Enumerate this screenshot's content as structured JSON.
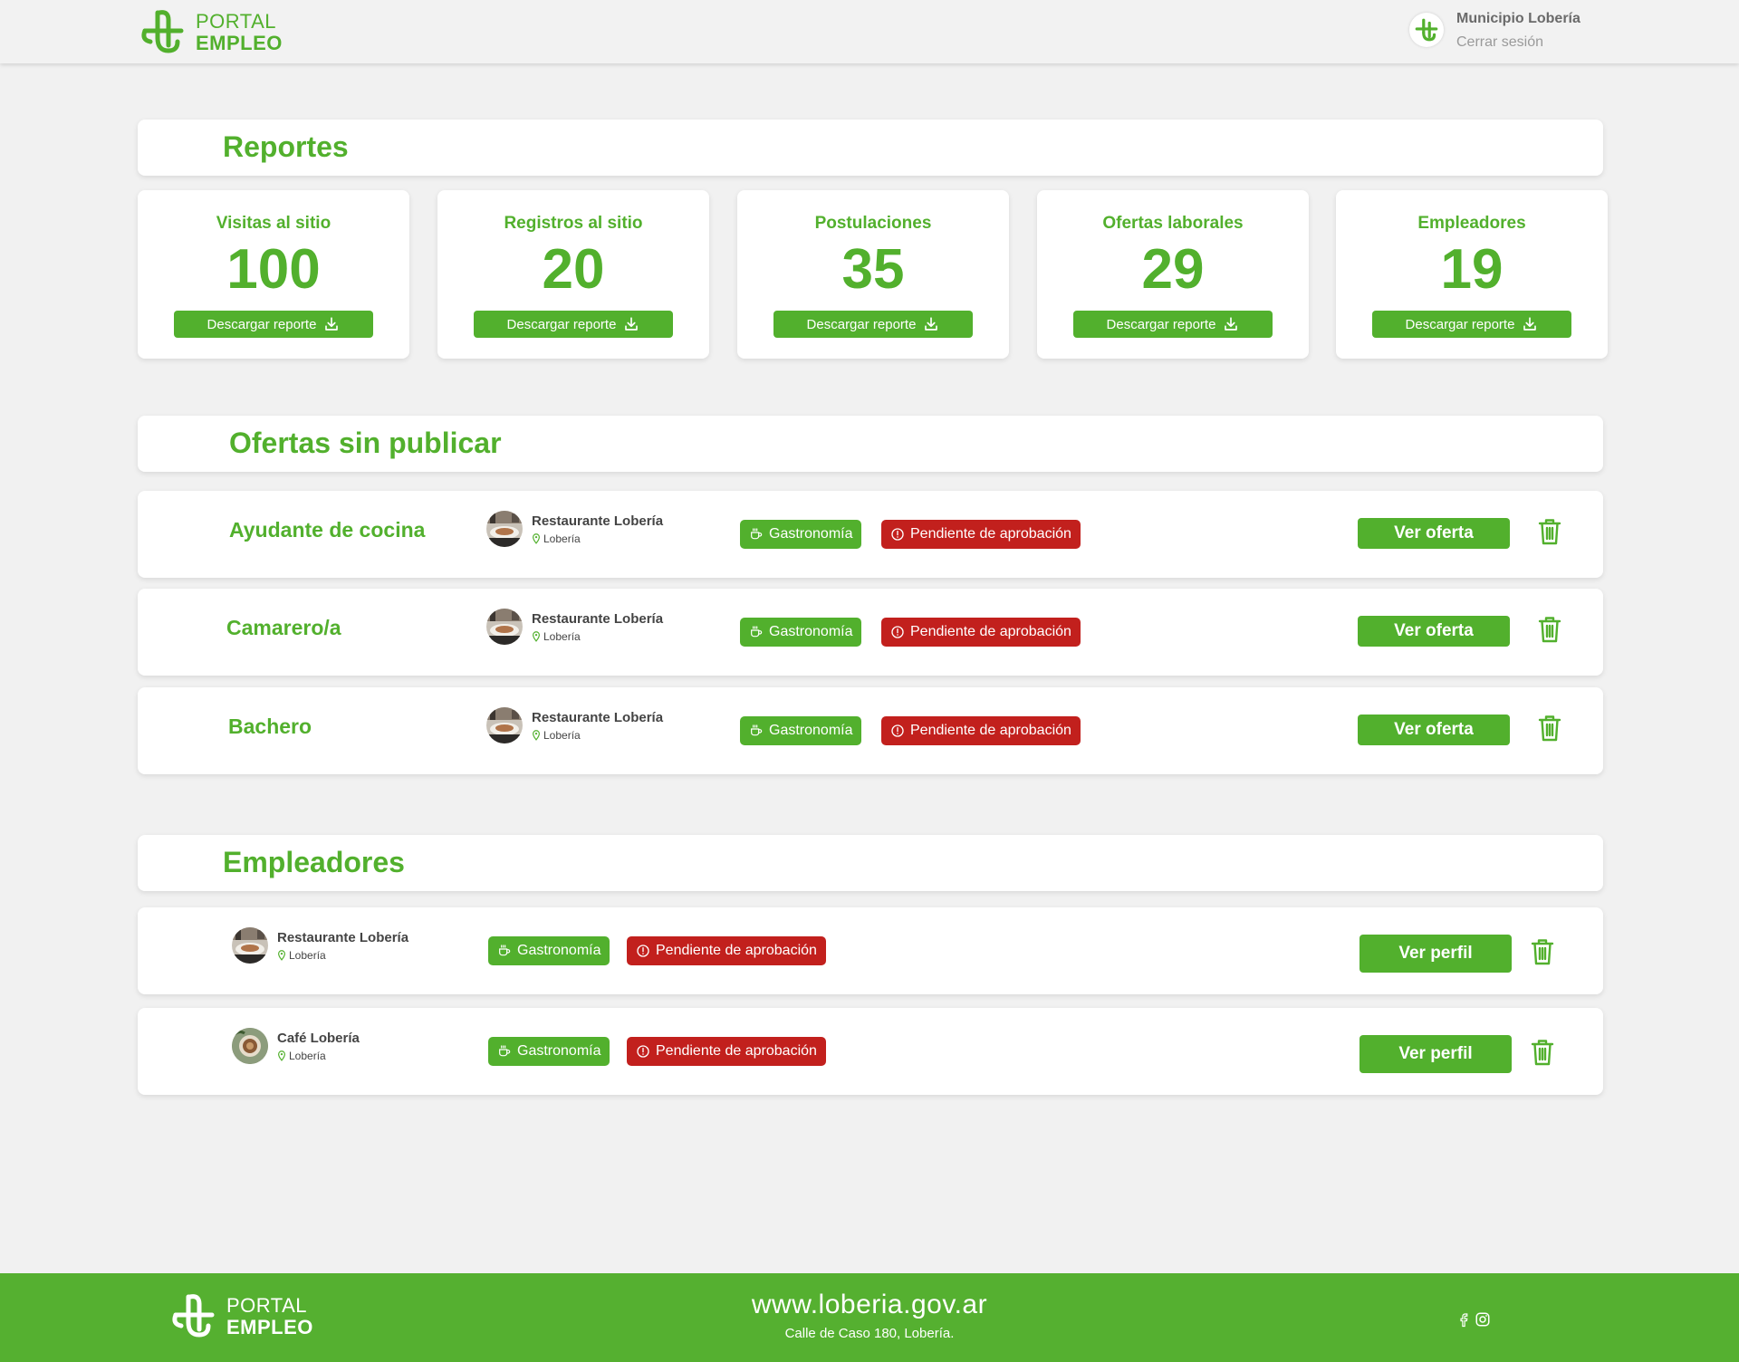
{
  "brand": {
    "line1": "PORTAL",
    "line2": "EMPLEO",
    "green": "#52b02d",
    "red": "#c2201d"
  },
  "header": {
    "user_name": "Municipio Lobería",
    "logout_label": "Cerrar sesión"
  },
  "reports": {
    "title": "Reportes",
    "download_label": "Descargar reporte",
    "stats": [
      {
        "label": "Visitas al sitio",
        "value": "100"
      },
      {
        "label": "Registros al sitio",
        "value": "20"
      },
      {
        "label": "Postulaciones",
        "value": "35"
      },
      {
        "label": "Ofertas laborales",
        "value": "29"
      },
      {
        "label": "Empleadores",
        "value": "19"
      }
    ]
  },
  "offers": {
    "title": "Ofertas sin publicar",
    "action_label": "Ver oferta",
    "items": [
      {
        "title": "Ayudante de cocina",
        "company": "Restaurante Lobería",
        "location": "Lobería",
        "category": "Gastronomía",
        "status": "Pendiente de aprobación"
      },
      {
        "title": "Camarero/a",
        "company": "Restaurante Lobería",
        "location": "Lobería",
        "category": "Gastronomía",
        "status": "Pendiente de aprobación"
      },
      {
        "title": "Bachero",
        "company": "Restaurante Lobería",
        "location": "Lobería",
        "category": "Gastronomía",
        "status": "Pendiente de aprobación"
      }
    ]
  },
  "employers": {
    "title": "Empleadores",
    "action_label": "Ver perfil",
    "items": [
      {
        "company": "Restaurante Lobería",
        "location": "Lobería",
        "category": "Gastronomía",
        "status": "Pendiente de aprobación"
      },
      {
        "company": "Café Lobería",
        "location": "Lobería",
        "category": "Gastronomía",
        "status": "Pendiente de aprobación"
      }
    ]
  },
  "footer": {
    "url": "www.loberia.gov.ar",
    "address": "Calle de Caso 180, Lobería.",
    "social": [
      "facebook-icon",
      "instagram-icon"
    ]
  }
}
